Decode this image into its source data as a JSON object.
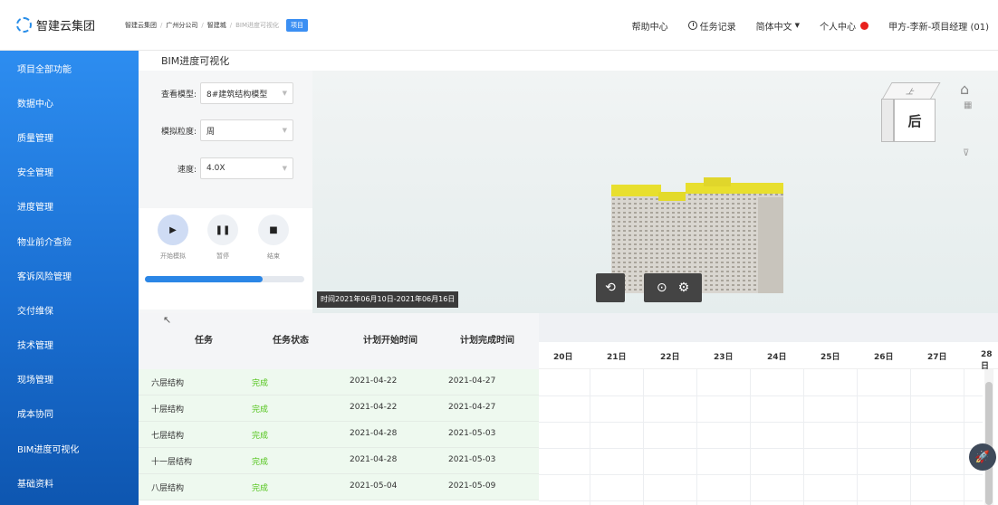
{
  "app": {
    "logo_text": "智建云集团"
  },
  "breadcrumb": {
    "items": [
      "智建云集团",
      "广州分公司",
      "智建城",
      "BIM进度可视化"
    ],
    "tag": "项目"
  },
  "topnav": {
    "help": "帮助中心",
    "tasks": "任务记录",
    "language": "简体中文",
    "profile": "个人中心",
    "user": "甲方-李新-项目经理 (01)"
  },
  "sidebar": {
    "items": [
      {
        "label": "项目全部功能"
      },
      {
        "label": "数据中心"
      },
      {
        "label": "质量管理"
      },
      {
        "label": "安全管理"
      },
      {
        "label": "进度管理"
      },
      {
        "label": "物业前介查验"
      },
      {
        "label": "客诉风险管理"
      },
      {
        "label": "交付维保"
      },
      {
        "label": "技术管理"
      },
      {
        "label": "现场管理"
      },
      {
        "label": "成本协同"
      },
      {
        "label": "BIM进度可视化"
      },
      {
        "label": "基础资料"
      }
    ]
  },
  "page": {
    "title": "BIM进度可视化"
  },
  "controls": {
    "model": {
      "label": "查看模型:",
      "value": "8#建筑结构模型"
    },
    "granularity": {
      "label": "模拟粒度:",
      "value": "周"
    },
    "speed": {
      "label": "速度:",
      "value": "4.0X"
    },
    "start_label": "开始模拟",
    "pause_label": "暂停",
    "stop_label": "结束",
    "progress": 0.74
  },
  "viewport": {
    "timestamp": "时间2021年06月10日-2021年06月16日",
    "cube_face": "后",
    "cube_top": "上"
  },
  "table": {
    "columns": [
      "任务",
      "任务状态",
      "计划开始时间",
      "计划完成时间"
    ],
    "rows": [
      {
        "task": "六层结构",
        "status": "完成",
        "start": "2021-04-22",
        "end": "2021-04-27"
      },
      {
        "task": "十层结构",
        "status": "完成",
        "start": "2021-04-22",
        "end": "2021-04-27"
      },
      {
        "task": "七层结构",
        "status": "完成",
        "start": "2021-04-28",
        "end": "2021-05-03"
      },
      {
        "task": "十一层结构",
        "status": "完成",
        "start": "2021-04-28",
        "end": "2021-05-03"
      },
      {
        "task": "八层结构",
        "status": "完成",
        "start": "2021-05-04",
        "end": "2021-05-09"
      }
    ]
  },
  "gantt": {
    "days": [
      "20日",
      "21日",
      "22日",
      "23日",
      "24日",
      "25日",
      "26日",
      "27日",
      "28日"
    ]
  },
  "colors": {
    "sidebar_top": "#2d8df0",
    "sidebar_bottom": "#0e56b0",
    "accent": "#2b86e6",
    "status_done": "#52c41a",
    "row_bg": "#eef9ef",
    "profile_dot": "#e8201c"
  }
}
